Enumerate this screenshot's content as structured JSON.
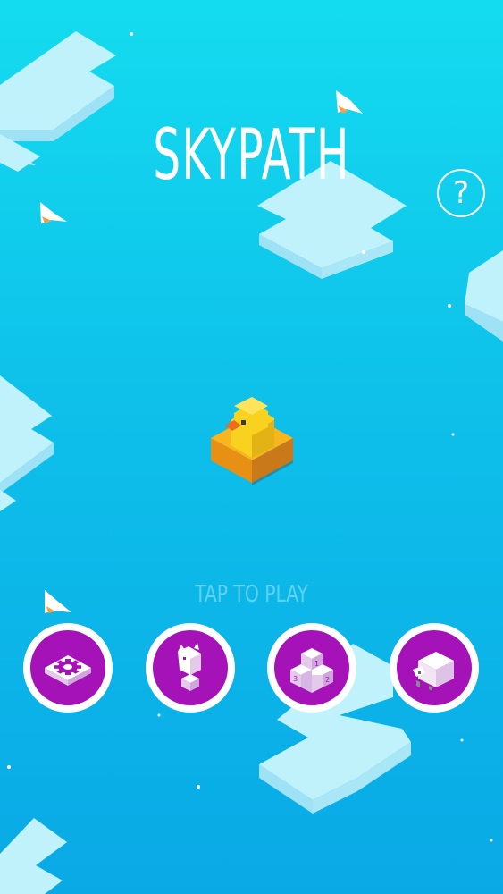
{
  "game": {
    "title": "SKYPATH",
    "help_label": "?",
    "tap_to_play": "TAP TO PLAY"
  },
  "menu": [
    {
      "id": "settings",
      "icon": "gear-block-icon"
    },
    {
      "id": "characters",
      "icon": "character-statue-icon"
    },
    {
      "id": "leaderboard",
      "icon": "podium-icon",
      "podium_labels": [
        "3",
        "1",
        "2"
      ]
    },
    {
      "id": "store",
      "icon": "sheep-block-icon"
    }
  ],
  "colors": {
    "sky_top": "#14dcef",
    "sky_bottom": "#09a9e6",
    "button_purple": "#a512b8",
    "cloud_top": "#bff2fb",
    "player_yellow": "#f8c91e"
  }
}
